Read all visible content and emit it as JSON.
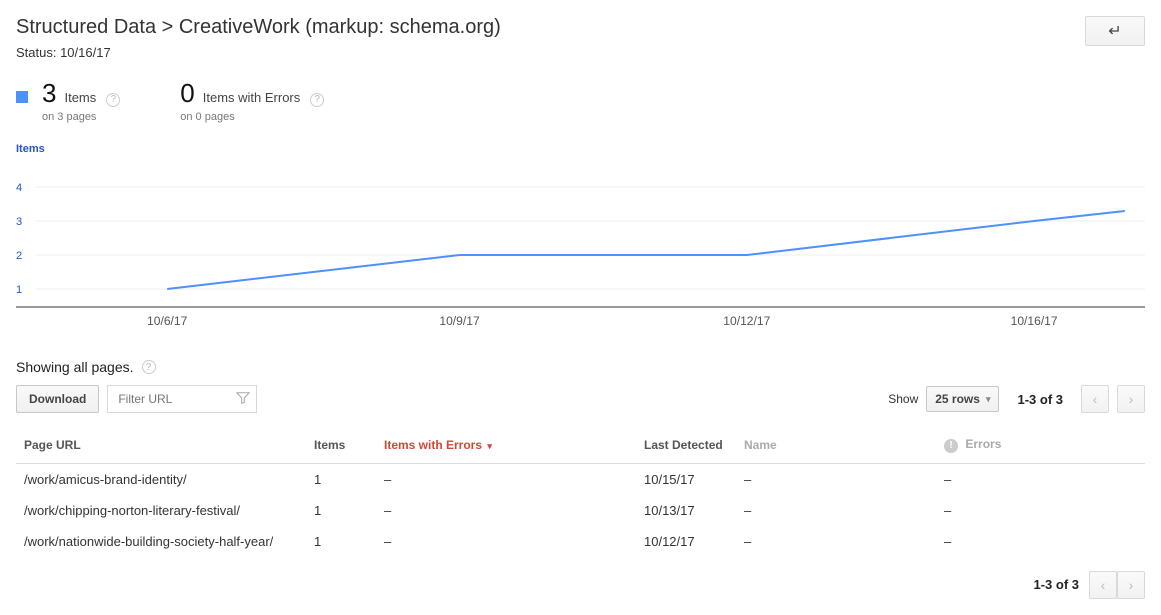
{
  "header": {
    "title": "Structured Data > CreativeWork (markup: schema.org)",
    "status": "Status: 10/16/17"
  },
  "metrics": {
    "items": {
      "count": "3",
      "label": "Items",
      "sub": "on 3 pages"
    },
    "errors": {
      "count": "0",
      "label": "Items with Errors",
      "sub": "on 0 pages"
    }
  },
  "chart_data": {
    "type": "line",
    "legend": "Items",
    "x": [
      "10/6/17",
      "10/9/17",
      "10/12/17",
      "10/16/17"
    ],
    "values": [
      1,
      2,
      2,
      3
    ],
    "ylim": [
      1,
      4
    ],
    "yticks": [
      1,
      2,
      3,
      4
    ]
  },
  "showing_text": "Showing all pages.",
  "toolbar": {
    "download": "Download",
    "filter_placeholder": "Filter URL",
    "show_label": "Show",
    "rows_option": "25 rows",
    "range": "1-3 of 3"
  },
  "table": {
    "headers": {
      "page_url": "Page URL",
      "items": "Items",
      "items_errors": "Items with Errors",
      "last_detected": "Last Detected",
      "name": "Name",
      "errors": "Errors"
    },
    "rows": [
      {
        "page_url": "/work/amicus-brand-identity/",
        "items": "1",
        "items_errors": "–",
        "last_detected": "10/15/17",
        "name": "–",
        "errors": "–"
      },
      {
        "page_url": "/work/chipping-norton-literary-festival/",
        "items": "1",
        "items_errors": "–",
        "last_detected": "10/13/17",
        "name": "–",
        "errors": "–"
      },
      {
        "page_url": "/work/nationwide-building-society-half-year/",
        "items": "1",
        "items_errors": "–",
        "last_detected": "10/12/17",
        "name": "–",
        "errors": "–"
      }
    ]
  },
  "footer_range": "1-3 of 3"
}
